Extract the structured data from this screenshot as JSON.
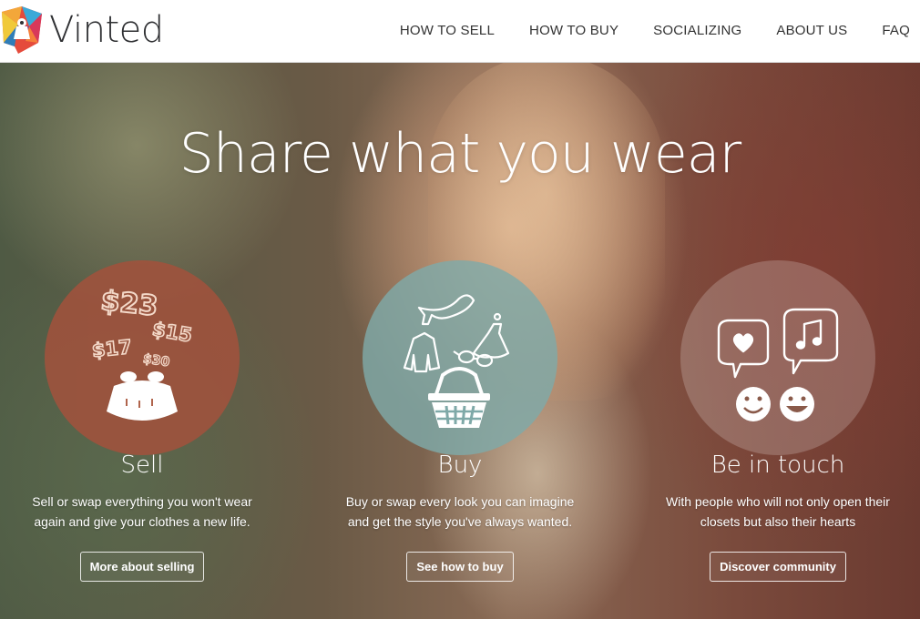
{
  "brand": {
    "name": "Vinted"
  },
  "nav": {
    "items": [
      "HOW TO SELL",
      "HOW TO BUY",
      "SOCIALIZING",
      "ABOUT US",
      "FAQ"
    ]
  },
  "hero": {
    "headline": "Share what you wear"
  },
  "features": [
    {
      "title": "Sell",
      "desc_line1": "Sell or swap everything you won't wear",
      "desc_line2": "again and give your clothes a new life.",
      "button": "More about selling",
      "circle_color": "#a0523c",
      "prices": [
        "$23",
        "$15",
        "$17",
        "$30"
      ]
    },
    {
      "title": "Buy",
      "desc_line1": "Buy or swap every look you can imagine",
      "desc_line2": "and get the style you've always wanted.",
      "button": "See how to buy",
      "circle_color": "#7fa9a8"
    },
    {
      "title": "Be in touch",
      "desc_line1": "With people who will not only open their",
      "desc_line2": "closets but also their hearts",
      "button": "Discover community",
      "circle_color": "#ffffff"
    }
  ]
}
